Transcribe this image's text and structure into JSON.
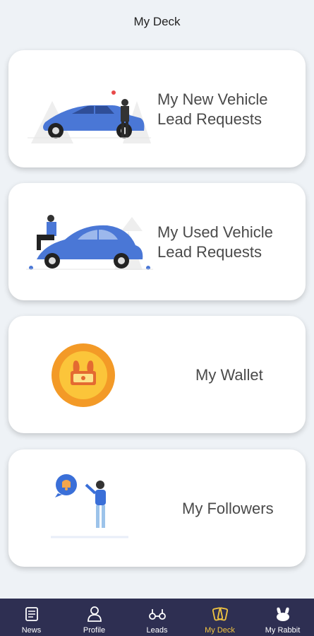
{
  "header": {
    "title": "My Deck"
  },
  "cards": [
    {
      "label_line1": "My New Vehicle",
      "label_line2": "Lead Requests"
    },
    {
      "label_line1": "My Used Vehicle",
      "label_line2": "Lead Requests"
    },
    {
      "label": "My Wallet"
    },
    {
      "label": "My Followers"
    }
  ],
  "navbar": {
    "items": [
      {
        "label": "News",
        "icon": "news-icon"
      },
      {
        "label": "Profile",
        "icon": "profile-icon"
      },
      {
        "label": "Leads",
        "icon": "leads-icon"
      },
      {
        "label": "My Deck",
        "icon": "deck-cards-icon",
        "active": true
      },
      {
        "label": "My Rabbit",
        "icon": "rabbit-icon"
      }
    ]
  },
  "colors": {
    "background": "#eef2f6",
    "navbar": "#2e2f52",
    "active": "#f2c541",
    "car_blue": "#4a77d6",
    "wallet_orange": "#f39a27"
  }
}
